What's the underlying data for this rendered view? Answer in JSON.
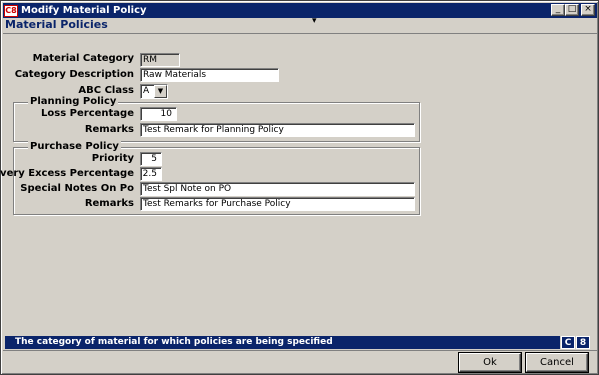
{
  "window": {
    "title": "Modify Material Policy",
    "icon_label": "C8",
    "controls": {
      "minimize": "_",
      "maximize": "□",
      "close": "×"
    }
  },
  "form": {
    "title": "Material Policies",
    "header_mark": "▾"
  },
  "fields": {
    "material_category": {
      "label": "Material Category",
      "value": "RM"
    },
    "category_description": {
      "label": "Category Description",
      "value": "Raw Materials"
    },
    "abc_class": {
      "label": "ABC Class",
      "value": "A",
      "dropdown_icon": "▼"
    }
  },
  "planning_policy": {
    "title": "Planning Policy",
    "loss_percentage": {
      "label": "Loss Percentage",
      "value": "10"
    },
    "remarks": {
      "label": "Remarks",
      "value": "Test Remark for Planning Policy"
    }
  },
  "purchase_policy": {
    "title": "Purchase Policy",
    "priority": {
      "label": "Priority",
      "value": "5"
    },
    "delivery_excess": {
      "label": "Delivery Excess Percentage",
      "value": "2.5"
    },
    "special_notes": {
      "label": "Special Notes On Po",
      "value": "Test Spl Note on PO"
    },
    "remarks": {
      "label": "Remarks",
      "value": "Test Remarks for Purchase Policy"
    }
  },
  "status": {
    "text": "The category of material for which policies are being specified",
    "box1": "C",
    "box2": "8"
  },
  "buttons": {
    "ok": "Ok",
    "cancel": "Cancel"
  }
}
